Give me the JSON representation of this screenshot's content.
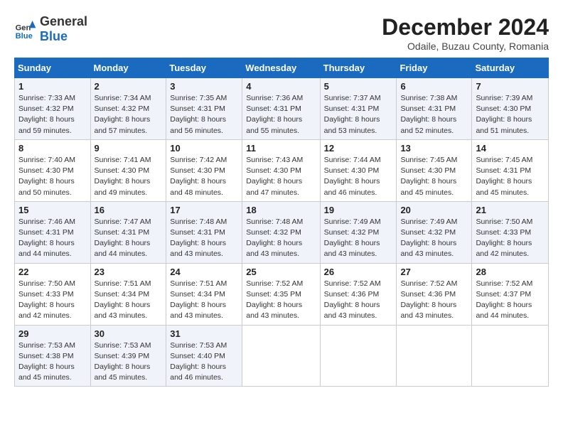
{
  "header": {
    "logo_general": "General",
    "logo_blue": "Blue",
    "month": "December 2024",
    "location": "Odaile, Buzau County, Romania"
  },
  "weekdays": [
    "Sunday",
    "Monday",
    "Tuesday",
    "Wednesday",
    "Thursday",
    "Friday",
    "Saturday"
  ],
  "weeks": [
    [
      {
        "day": "1",
        "sunrise": "Sunrise: 7:33 AM",
        "sunset": "Sunset: 4:32 PM",
        "daylight": "Daylight: 8 hours and 59 minutes."
      },
      {
        "day": "2",
        "sunrise": "Sunrise: 7:34 AM",
        "sunset": "Sunset: 4:32 PM",
        "daylight": "Daylight: 8 hours and 57 minutes."
      },
      {
        "day": "3",
        "sunrise": "Sunrise: 7:35 AM",
        "sunset": "Sunset: 4:31 PM",
        "daylight": "Daylight: 8 hours and 56 minutes."
      },
      {
        "day": "4",
        "sunrise": "Sunrise: 7:36 AM",
        "sunset": "Sunset: 4:31 PM",
        "daylight": "Daylight: 8 hours and 55 minutes."
      },
      {
        "day": "5",
        "sunrise": "Sunrise: 7:37 AM",
        "sunset": "Sunset: 4:31 PM",
        "daylight": "Daylight: 8 hours and 53 minutes."
      },
      {
        "day": "6",
        "sunrise": "Sunrise: 7:38 AM",
        "sunset": "Sunset: 4:31 PM",
        "daylight": "Daylight: 8 hours and 52 minutes."
      },
      {
        "day": "7",
        "sunrise": "Sunrise: 7:39 AM",
        "sunset": "Sunset: 4:30 PM",
        "daylight": "Daylight: 8 hours and 51 minutes."
      }
    ],
    [
      {
        "day": "8",
        "sunrise": "Sunrise: 7:40 AM",
        "sunset": "Sunset: 4:30 PM",
        "daylight": "Daylight: 8 hours and 50 minutes."
      },
      {
        "day": "9",
        "sunrise": "Sunrise: 7:41 AM",
        "sunset": "Sunset: 4:30 PM",
        "daylight": "Daylight: 8 hours and 49 minutes."
      },
      {
        "day": "10",
        "sunrise": "Sunrise: 7:42 AM",
        "sunset": "Sunset: 4:30 PM",
        "daylight": "Daylight: 8 hours and 48 minutes."
      },
      {
        "day": "11",
        "sunrise": "Sunrise: 7:43 AM",
        "sunset": "Sunset: 4:30 PM",
        "daylight": "Daylight: 8 hours and 47 minutes."
      },
      {
        "day": "12",
        "sunrise": "Sunrise: 7:44 AM",
        "sunset": "Sunset: 4:30 PM",
        "daylight": "Daylight: 8 hours and 46 minutes."
      },
      {
        "day": "13",
        "sunrise": "Sunrise: 7:45 AM",
        "sunset": "Sunset: 4:30 PM",
        "daylight": "Daylight: 8 hours and 45 minutes."
      },
      {
        "day": "14",
        "sunrise": "Sunrise: 7:45 AM",
        "sunset": "Sunset: 4:31 PM",
        "daylight": "Daylight: 8 hours and 45 minutes."
      }
    ],
    [
      {
        "day": "15",
        "sunrise": "Sunrise: 7:46 AM",
        "sunset": "Sunset: 4:31 PM",
        "daylight": "Daylight: 8 hours and 44 minutes."
      },
      {
        "day": "16",
        "sunrise": "Sunrise: 7:47 AM",
        "sunset": "Sunset: 4:31 PM",
        "daylight": "Daylight: 8 hours and 44 minutes."
      },
      {
        "day": "17",
        "sunrise": "Sunrise: 7:48 AM",
        "sunset": "Sunset: 4:31 PM",
        "daylight": "Daylight: 8 hours and 43 minutes."
      },
      {
        "day": "18",
        "sunrise": "Sunrise: 7:48 AM",
        "sunset": "Sunset: 4:32 PM",
        "daylight": "Daylight: 8 hours and 43 minutes."
      },
      {
        "day": "19",
        "sunrise": "Sunrise: 7:49 AM",
        "sunset": "Sunset: 4:32 PM",
        "daylight": "Daylight: 8 hours and 43 minutes."
      },
      {
        "day": "20",
        "sunrise": "Sunrise: 7:49 AM",
        "sunset": "Sunset: 4:32 PM",
        "daylight": "Daylight: 8 hours and 43 minutes."
      },
      {
        "day": "21",
        "sunrise": "Sunrise: 7:50 AM",
        "sunset": "Sunset: 4:33 PM",
        "daylight": "Daylight: 8 hours and 42 minutes."
      }
    ],
    [
      {
        "day": "22",
        "sunrise": "Sunrise: 7:50 AM",
        "sunset": "Sunset: 4:33 PM",
        "daylight": "Daylight: 8 hours and 42 minutes."
      },
      {
        "day": "23",
        "sunrise": "Sunrise: 7:51 AM",
        "sunset": "Sunset: 4:34 PM",
        "daylight": "Daylight: 8 hours and 43 minutes."
      },
      {
        "day": "24",
        "sunrise": "Sunrise: 7:51 AM",
        "sunset": "Sunset: 4:34 PM",
        "daylight": "Daylight: 8 hours and 43 minutes."
      },
      {
        "day": "25",
        "sunrise": "Sunrise: 7:52 AM",
        "sunset": "Sunset: 4:35 PM",
        "daylight": "Daylight: 8 hours and 43 minutes."
      },
      {
        "day": "26",
        "sunrise": "Sunrise: 7:52 AM",
        "sunset": "Sunset: 4:36 PM",
        "daylight": "Daylight: 8 hours and 43 minutes."
      },
      {
        "day": "27",
        "sunrise": "Sunrise: 7:52 AM",
        "sunset": "Sunset: 4:36 PM",
        "daylight": "Daylight: 8 hours and 43 minutes."
      },
      {
        "day": "28",
        "sunrise": "Sunrise: 7:52 AM",
        "sunset": "Sunset: 4:37 PM",
        "daylight": "Daylight: 8 hours and 44 minutes."
      }
    ],
    [
      {
        "day": "29",
        "sunrise": "Sunrise: 7:53 AM",
        "sunset": "Sunset: 4:38 PM",
        "daylight": "Daylight: 8 hours and 45 minutes."
      },
      {
        "day": "30",
        "sunrise": "Sunrise: 7:53 AM",
        "sunset": "Sunset: 4:39 PM",
        "daylight": "Daylight: 8 hours and 45 minutes."
      },
      {
        "day": "31",
        "sunrise": "Sunrise: 7:53 AM",
        "sunset": "Sunset: 4:40 PM",
        "daylight": "Daylight: 8 hours and 46 minutes."
      },
      null,
      null,
      null,
      null
    ]
  ]
}
